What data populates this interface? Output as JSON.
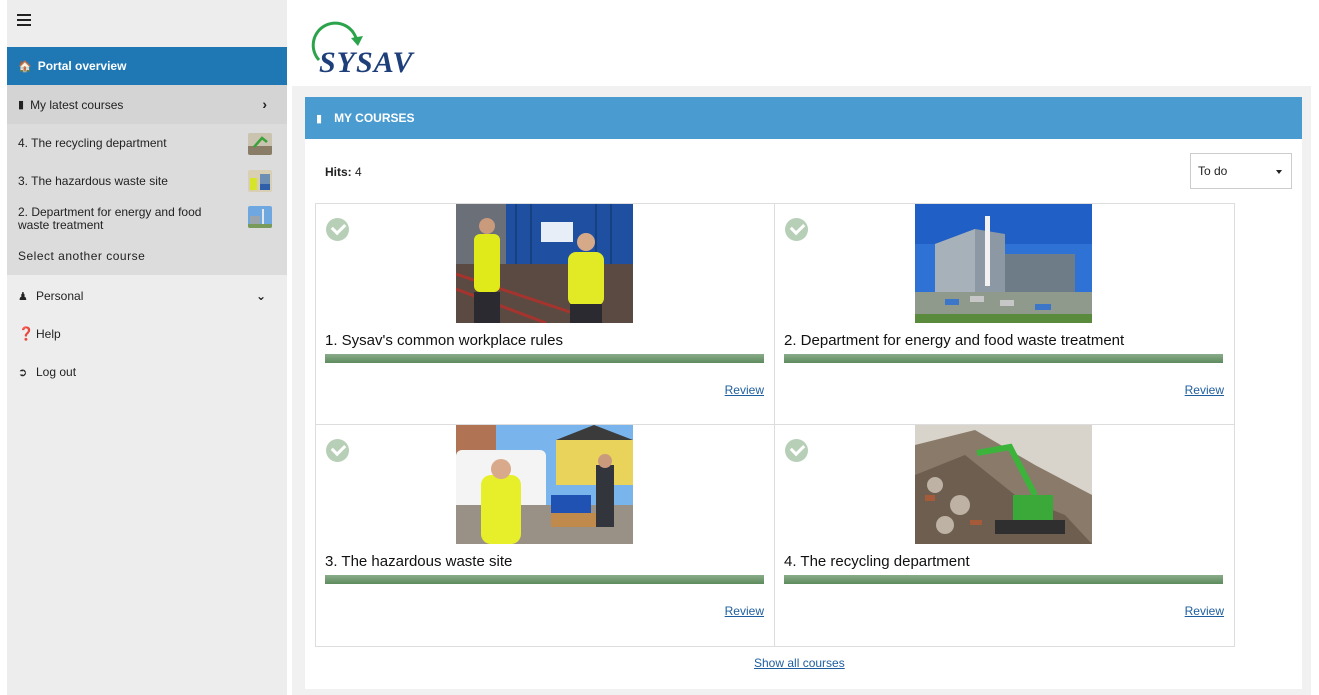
{
  "sidebar": {
    "portal_label": "Portal overview",
    "latest_label": "My latest courses",
    "latest_items": [
      {
        "label": "4. The recycling department"
      },
      {
        "label": "3. The hazardous waste site"
      },
      {
        "label": "2. Department for energy and food waste treatment"
      }
    ],
    "select_label": "Select another course",
    "personal_label": "Personal",
    "help_label": "Help",
    "logout_label": "Log out"
  },
  "header": {
    "logo_text": "SYSAV"
  },
  "main": {
    "section_title": "MY COURSES",
    "hits_label": "Hits:",
    "hits_value": "4",
    "filter_value": "To do",
    "courses": [
      {
        "title": "1. Sysav's common workplace rules",
        "action": "Review",
        "progress": 100
      },
      {
        "title": "2. Department for energy and food waste treatment",
        "action": "Review",
        "progress": 100
      },
      {
        "title": "3. The hazardous waste site",
        "action": "Review",
        "progress": 100
      },
      {
        "title": "4. The recycling department",
        "action": "Review",
        "progress": 100
      }
    ],
    "show_all_label": "Show all courses"
  },
  "colors": {
    "primary": "#1f78b4",
    "section_bar": "#4a9bd0",
    "progress": "#5e8b5e",
    "link": "#1f5e9e"
  }
}
